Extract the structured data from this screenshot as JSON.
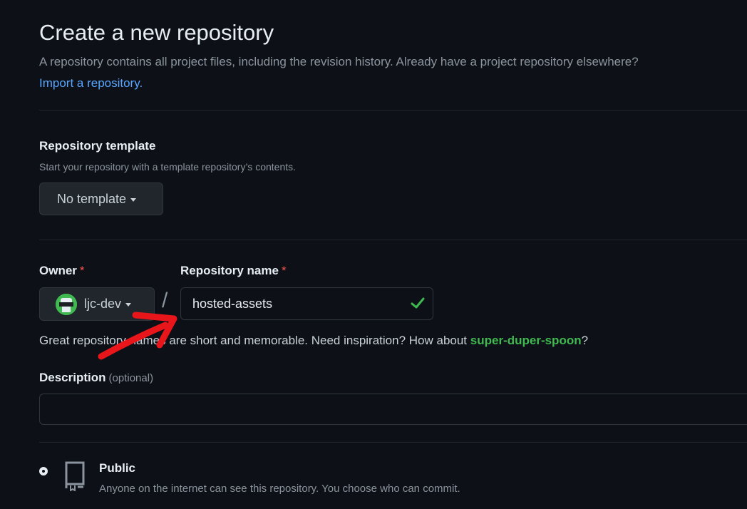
{
  "header": {
    "title": "Create a new repository",
    "intro": "A repository contains all project files, including the revision history. Already have a project repository elsewhere?",
    "import_link": "Import a repository."
  },
  "template": {
    "label": "Repository template",
    "hint": "Start your repository with a template repository’s contents.",
    "selected": "No template"
  },
  "owner": {
    "label": "Owner",
    "required_mark": "*",
    "value": "ljc-dev",
    "separator": "/"
  },
  "repo_name": {
    "label": "Repository name",
    "required_mark": "*",
    "value": "hosted-assets",
    "valid": true,
    "hint_text": "Great repository names are short and memorable. Need inspiration? How about ",
    "suggestion": "super-duper-spoon",
    "hint_suffix": "?"
  },
  "description": {
    "label": "Description",
    "optional": "(optional)",
    "value": ""
  },
  "visibility": {
    "options": [
      {
        "label": "Public",
        "hint": "Anyone on the internet can see this repository. You choose who can commit.",
        "selected": true
      }
    ]
  },
  "colors": {
    "background": "#0d1117",
    "link": "#58a6ff",
    "success": "#3fb950",
    "required": "#f85149",
    "annotation_arrow": "#e8161b"
  }
}
